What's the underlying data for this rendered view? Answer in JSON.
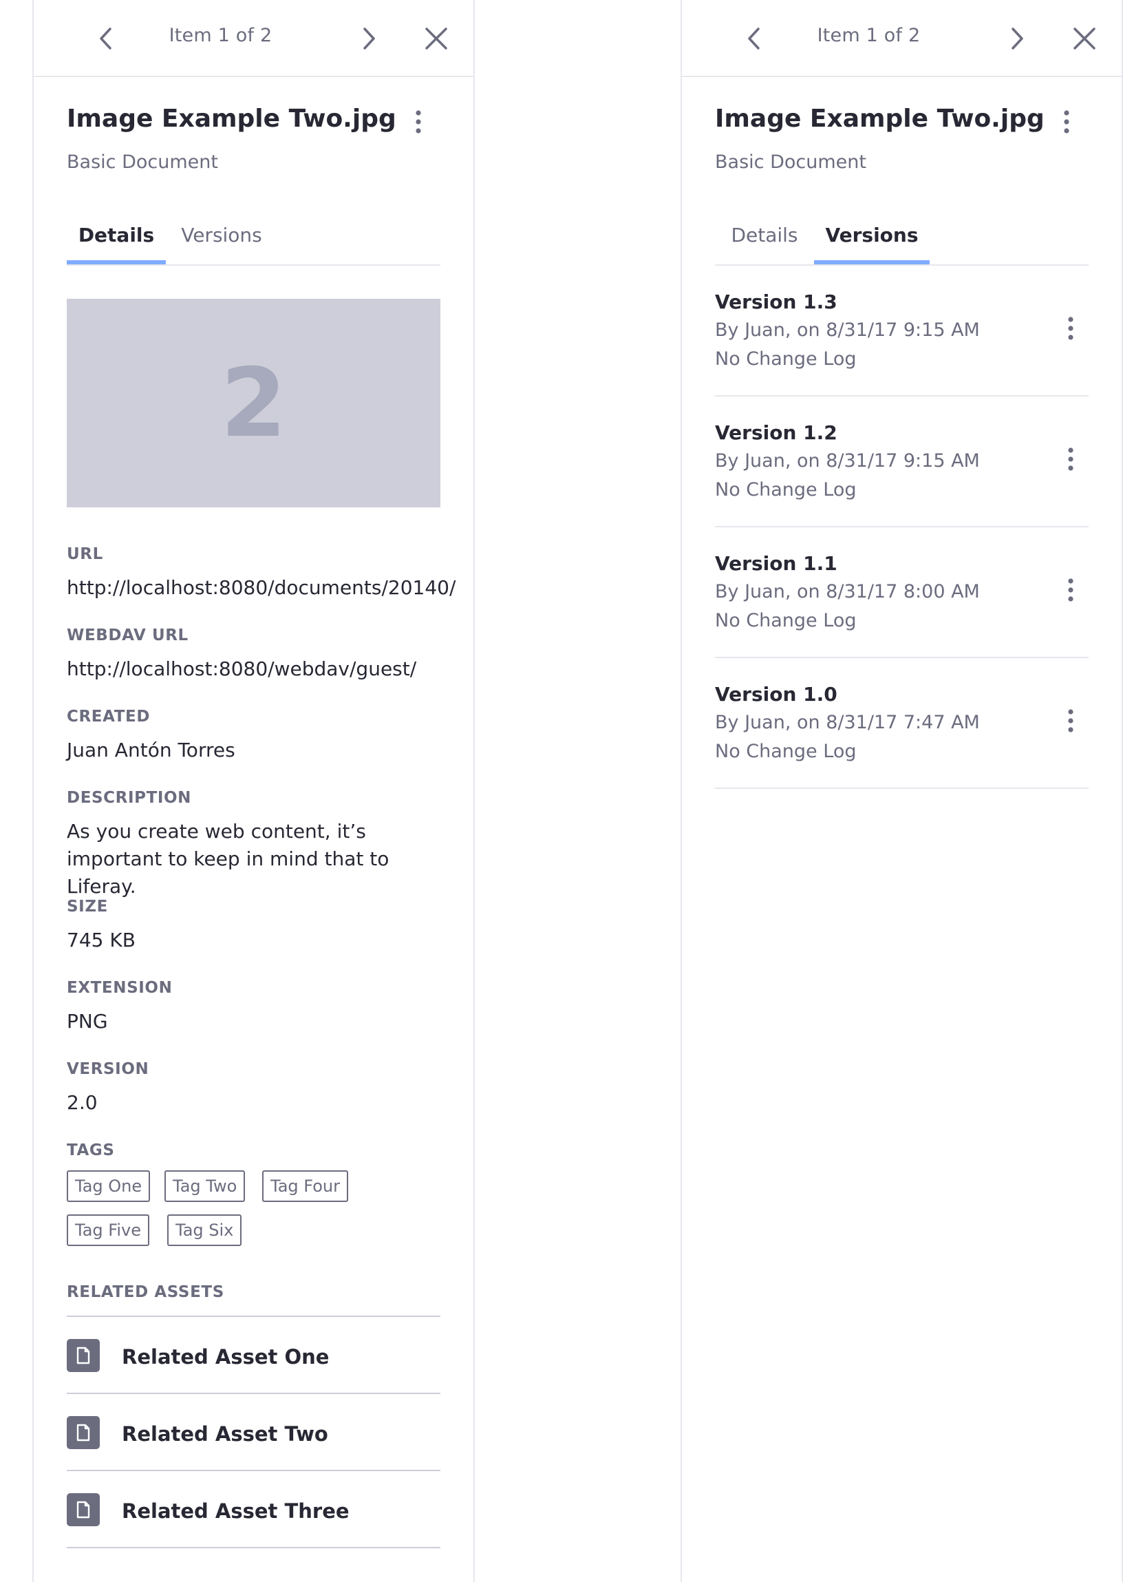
{
  "colors": {
    "accent": "#80acff",
    "text_primary": "#272833",
    "text_secondary": "#6b6c7e",
    "preview_bg": "#cdced9",
    "border": "#e7e7ed"
  },
  "left_panel": {
    "counter": "Item 1 of 2",
    "title": "Image Example Two.jpg",
    "subtitle": "Basic Document",
    "tabs": [
      {
        "label": "Details",
        "active": true
      },
      {
        "label": "Versions",
        "active": false
      }
    ],
    "preview": {
      "number": "2"
    },
    "fields": {
      "url": {
        "label": "URL",
        "value": "http://localhost:8080/documents/20140/"
      },
      "webdav": {
        "label": "WEBDAV URL",
        "value": "http://localhost:8080/webdav/guest/"
      },
      "created": {
        "label": "CREATED",
        "value": "Juan Antón Torres"
      },
      "description": {
        "label": "DESCRIPTION",
        "value": "As you create web content, it’s important to keep in mind that to Liferay."
      },
      "size": {
        "label": "SIZE",
        "value": "745 KB"
      },
      "extension": {
        "label": "EXTENSION",
        "value": "PNG"
      },
      "version": {
        "label": "VERSION",
        "value": "2.0"
      }
    },
    "tags": {
      "label": "TAGS",
      "items": [
        "Tag One",
        "Tag Two",
        "Tag Four",
        "Tag Five",
        "Tag Six"
      ]
    },
    "related_assets": {
      "label": "RELATED ASSETS",
      "items": [
        "Related Asset One",
        "Related Asset Two",
        "Related Asset Three"
      ]
    }
  },
  "right_panel": {
    "counter": "Item 1 of 2",
    "title": "Image Example Two.jpg",
    "subtitle": "Basic Document",
    "tabs": [
      {
        "label": "Details",
        "active": false
      },
      {
        "label": "Versions",
        "active": true
      }
    ],
    "versions": [
      {
        "title": "Version 1.3",
        "meta": "By Juan, on 8/31/17 9:15 AM",
        "log": "No Change Log"
      },
      {
        "title": "Version 1.2",
        "meta": "By Juan, on 8/31/17 9:15 AM",
        "log": "No Change Log"
      },
      {
        "title": "Version 1.1",
        "meta": "By Juan, on 8/31/17 8:00 AM",
        "log": "No Change Log"
      },
      {
        "title": "Version 1.0",
        "meta": "By Juan, on 8/31/17 7:47 AM",
        "log": "No Change Log"
      }
    ]
  }
}
